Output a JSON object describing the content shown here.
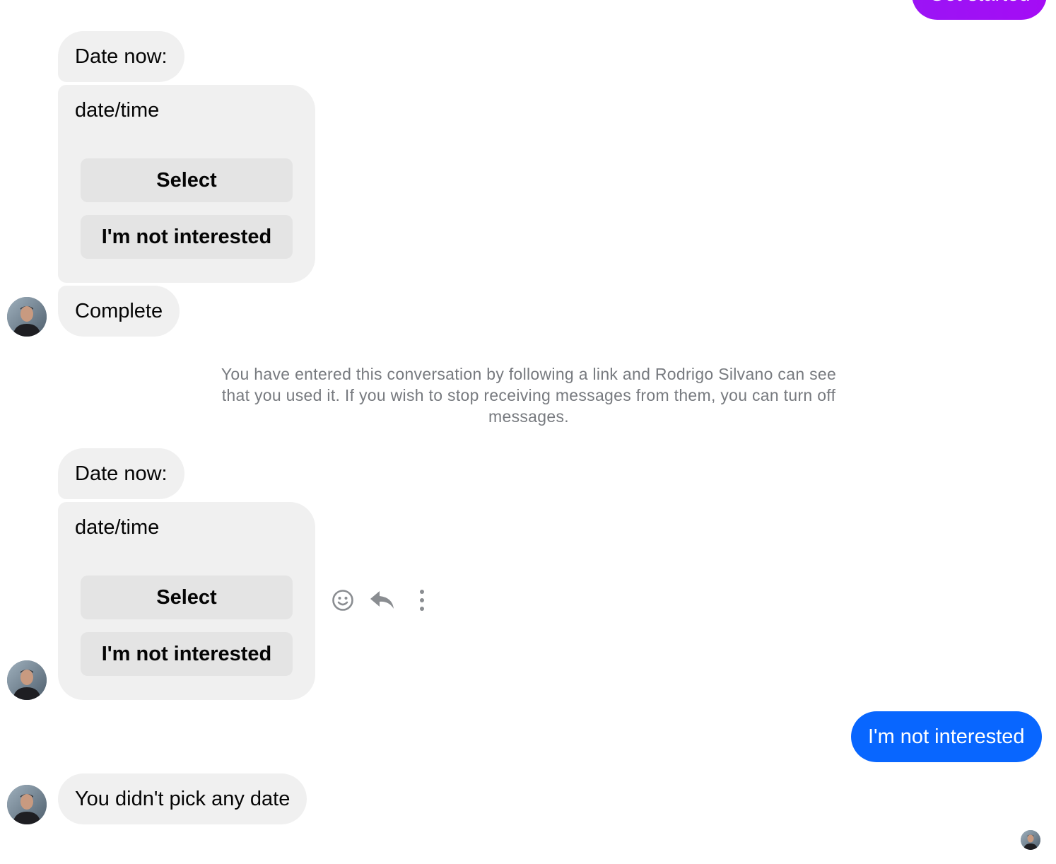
{
  "colors": {
    "incoming_bubble": "#f0f0f0",
    "button_bg": "#e4e4e4",
    "outgoing_blue": "#0866ff",
    "outgoing_purple": "#a40cf5",
    "notice_text": "#777a7f",
    "icon_grey": "#8a8d91"
  },
  "top_outgoing": {
    "label": "Get started"
  },
  "thread": {
    "group1": {
      "date_label": "Date now:",
      "card_text": "date/time",
      "select_label": "Select",
      "not_interested_label": "I'm not interested",
      "complete_label": "Complete"
    },
    "notice": "You have entered this conversation by following a link and Rodrigo Silvano can see that you used it. If you wish to stop receiving messages from them, you can turn off messages.",
    "group2": {
      "date_label": "Date now:",
      "card_text": "date/time",
      "select_label": "Select",
      "not_interested_label": "I'm not interested"
    },
    "outgoing_reply": "I'm not interested",
    "final_message": "You didn't pick any date"
  },
  "message_actions": {
    "react_icon": "smiley-icon",
    "reply_icon": "reply-arrow-icon",
    "more_icon": "vertical-dots-icon"
  },
  "avatar_person": "Rodrigo Silvano"
}
